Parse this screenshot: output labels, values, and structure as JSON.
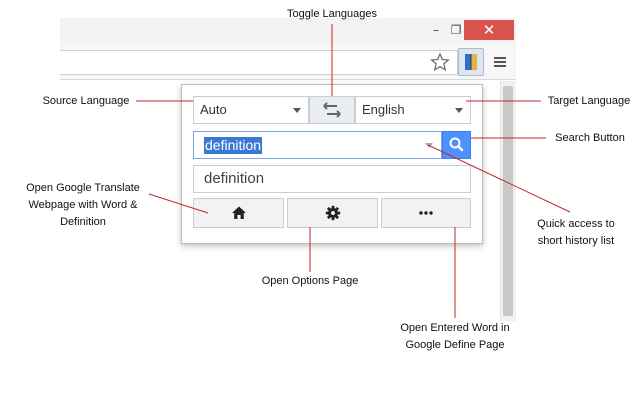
{
  "popup": {
    "source_language": "Auto",
    "target_language": "English",
    "search_value": "definition",
    "result_text": "definition"
  },
  "annotations": {
    "toggle_languages": "Toggle Languages",
    "source_language": "Source Language",
    "target_language": "Target Language",
    "search_button": "Search Button",
    "open_translate": "Open Google Translate Webpage with Word & Definition",
    "quick_access": "Quick access to short history list",
    "open_options": "Open Options Page",
    "open_define": "Open Entered Word in Google Define Page"
  },
  "icons": {
    "window_restore": "❐",
    "window_minimize": "–",
    "window_close": "✕"
  },
  "colors": {
    "annotation_line": "#c0282d",
    "search_button": "#4d90fe",
    "close_button": "#d9534f",
    "selection": "#3a78d4"
  }
}
